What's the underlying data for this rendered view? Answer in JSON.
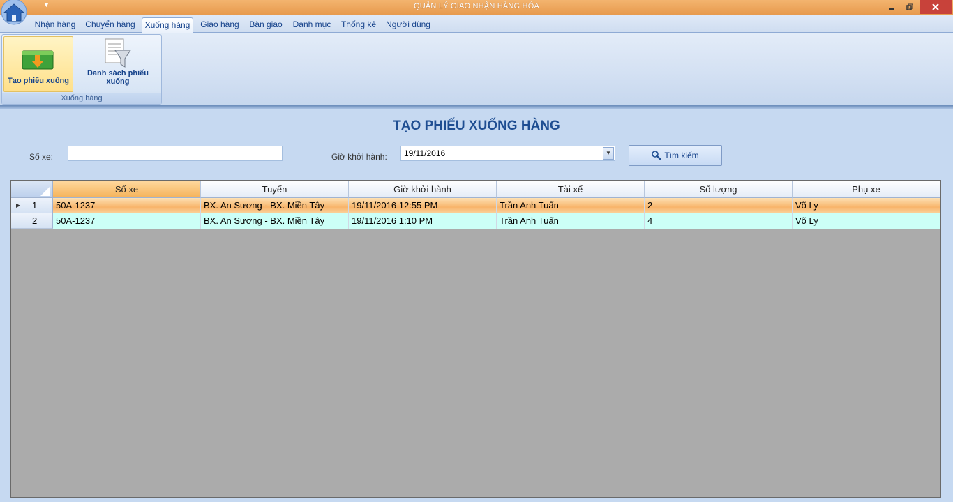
{
  "window": {
    "title": "QUẢN LÝ GIAO NHẬN HÀNG HÓA"
  },
  "tabs": [
    "Nhận hàng",
    "Chuyển hàng",
    "Xuống hàng",
    "Giao hàng",
    "Bàn giao",
    "Danh mục",
    "Thống kê",
    "Người dùng"
  ],
  "active_tab": "Xuống hàng",
  "ribbon": {
    "group_label": "Xuống hàng",
    "buttons": [
      {
        "label": "Tạo phiếu xuống",
        "icon": "green-box-down-arrow-icon",
        "selected": true
      },
      {
        "label": "Danh sách phiếu xuống",
        "icon": "document-funnel-icon",
        "selected": false
      }
    ]
  },
  "form": {
    "title": "TẠO PHIẾU XUỐNG HÀNG",
    "so_xe_label": "Số xe:",
    "so_xe_value": "",
    "gio_label": "Giờ khởi hành:",
    "gio_value": "19/11/2016",
    "search_label": "Tìm kiếm"
  },
  "grid": {
    "columns": [
      "Số xe",
      "Tuyến",
      "Giờ khởi hành",
      "Tài xế",
      "Số lượng",
      "Phụ xe"
    ],
    "rows": [
      {
        "index": "1",
        "so_xe": "50A-1237",
        "tuyen": "BX. An Sương - BX. Miền Tây",
        "gio": "19/11/2016 12:55 PM",
        "tai_xe": "Trần Anh Tuấn",
        "so_luong": "2",
        "phu_xe": "Võ Ly"
      },
      {
        "index": "2",
        "so_xe": "50A-1237",
        "tuyen": "BX. An Sương - BX. Miền Tây",
        "gio": "19/11/2016 1:10 PM",
        "tai_xe": "Trần Anh Tuấn",
        "so_luong": "4",
        "phu_xe": "Võ Ly"
      }
    ]
  },
  "colors": {
    "titlebar": "#e79a4d",
    "selected_row": "#f8b46a",
    "alt_row": "#ccfff7",
    "grid_empty": "#ababab",
    "heading": "#1f4e92"
  }
}
